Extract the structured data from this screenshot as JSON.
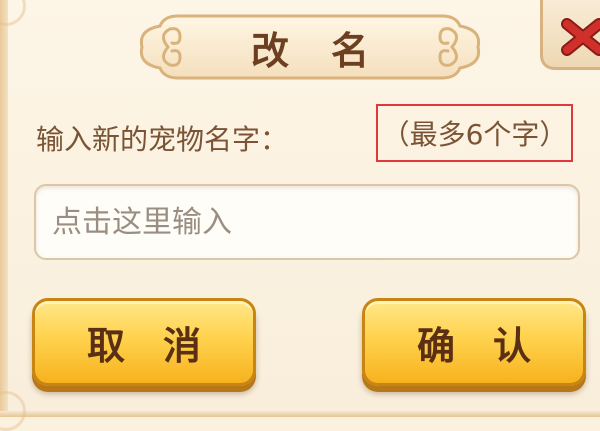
{
  "dialog": {
    "title": "改名",
    "prompt_label": "输入新的宠物名字：",
    "limit_note": "（最多6个字）",
    "input": {
      "value": "",
      "placeholder": "点击这里输入"
    },
    "buttons": {
      "cancel": "取消",
      "confirm": "确认"
    }
  },
  "icons": {
    "close": "close-icon"
  },
  "colors": {
    "background": "#fbf1df",
    "title_text": "#6b3f1f",
    "label_text": "#7a5434",
    "button_fill": "#ffd24e",
    "highlight_border": "#e0383c",
    "close_x": "#d0302a"
  }
}
